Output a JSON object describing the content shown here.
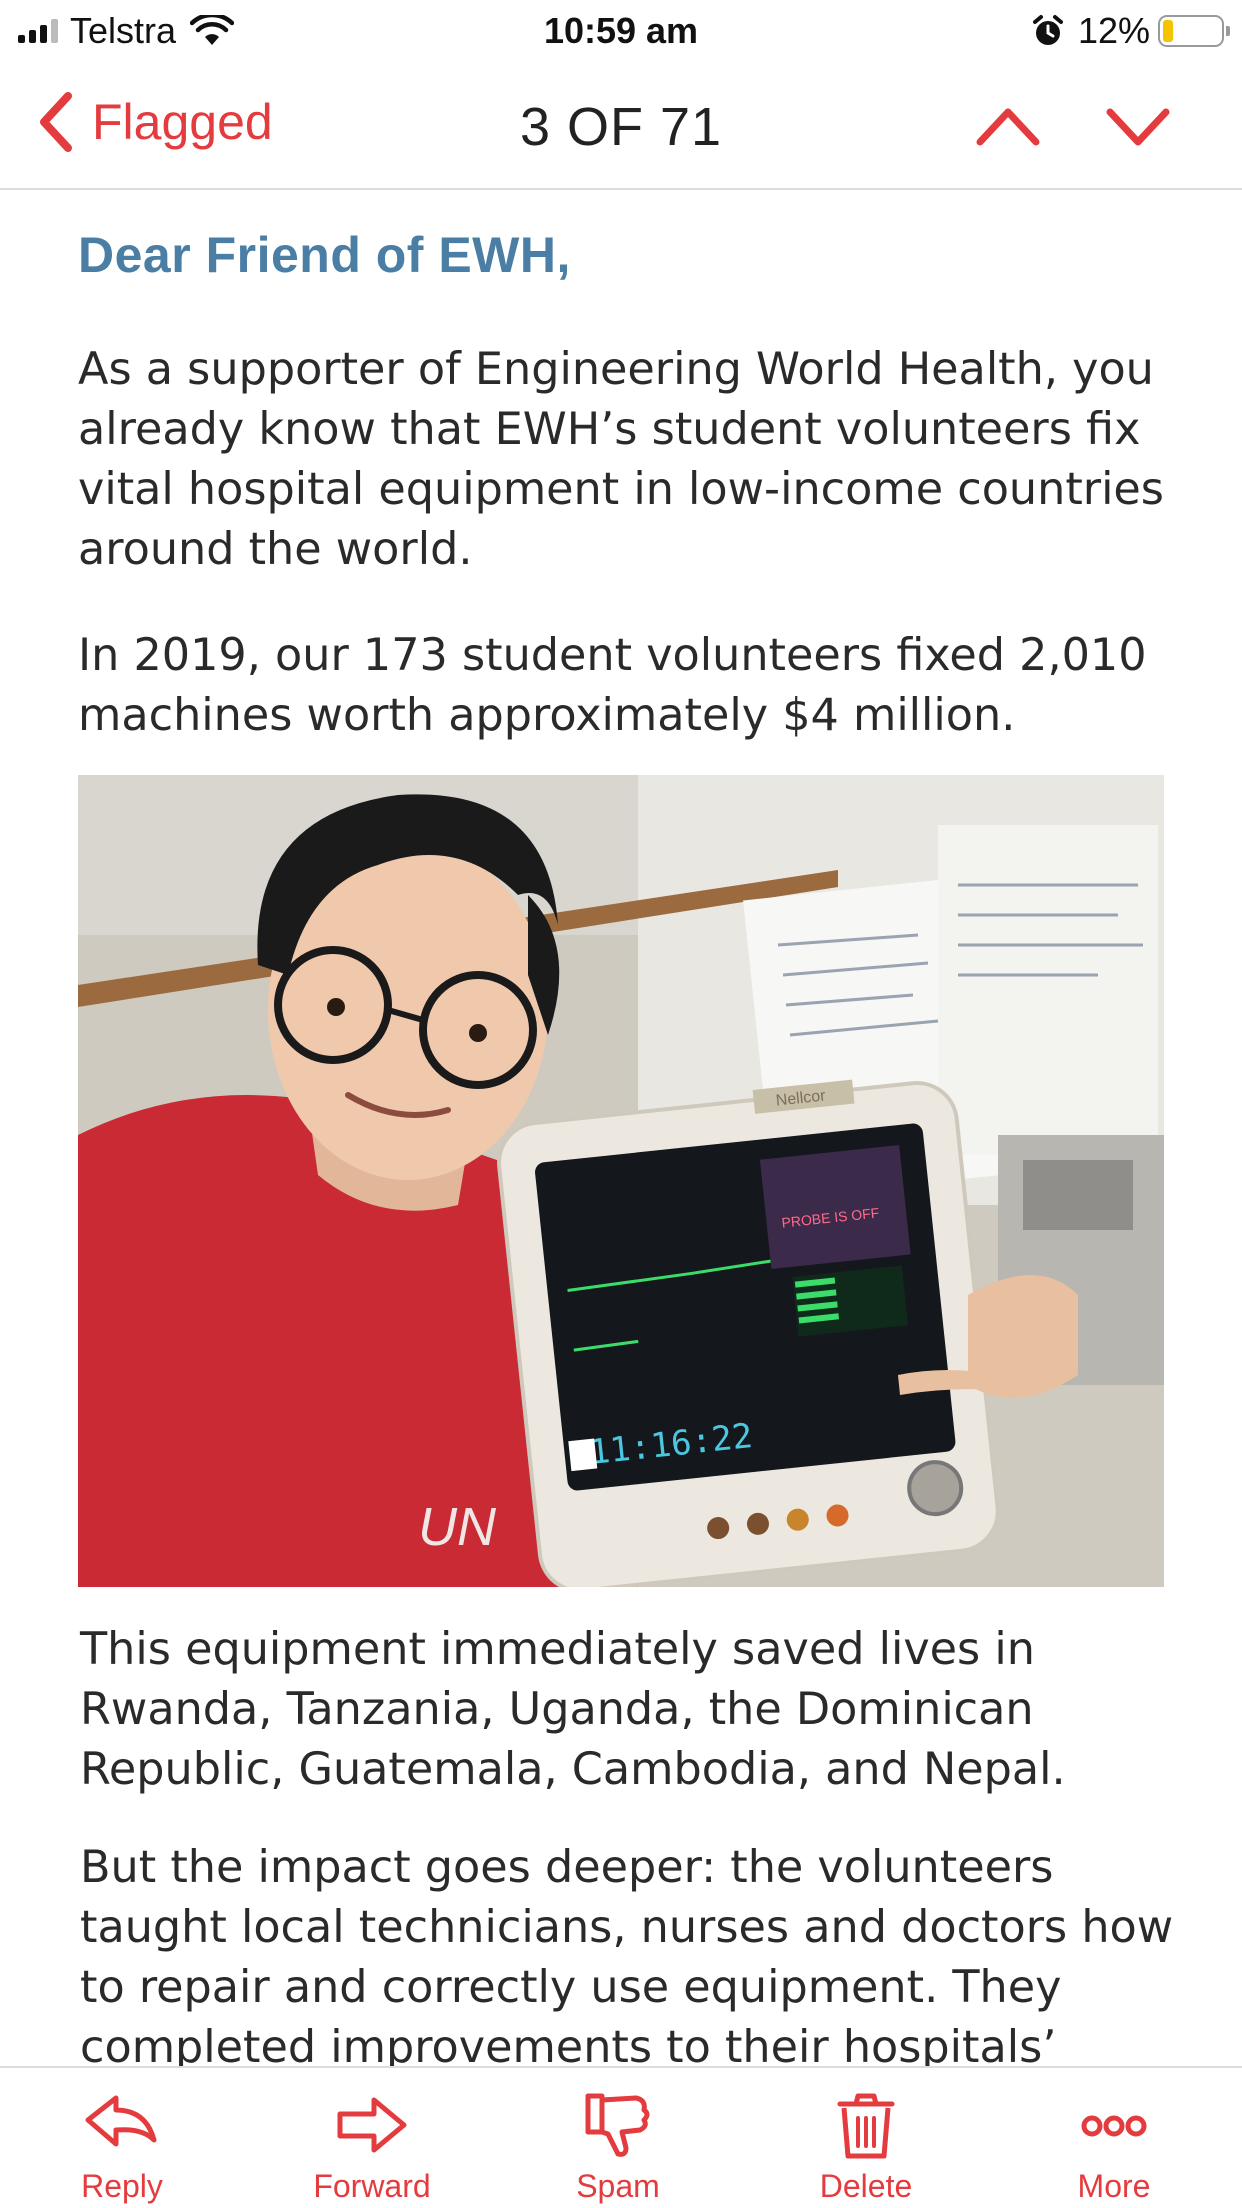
{
  "status_bar": {
    "carrier": "Telstra",
    "time": "10:59 am",
    "battery_percent": "12%",
    "battery_level": 0.12,
    "icons": [
      "signal-icon",
      "wifi-icon",
      "alarm-icon",
      "battery-icon"
    ]
  },
  "nav": {
    "back_label": "Flagged",
    "counter": "3 OF 71",
    "accent_color": "#e43b3f"
  },
  "email": {
    "greeting": "Dear Friend of EWH,",
    "paragraphs": [
      "As a supporter of Engineering World Health, you already know that EWH’s student volunteers fix vital hospital equipment in low-income countries around the world.",
      "In 2019, our 173 student volunteers fixed 2,010 machines worth approximately $4 million.",
      "This equipment immediately saved lives in Rwanda, Tanzania, Uganda, the Dominican Republic, Guatemala, Cambodia, and Nepal.",
      "But the impact goes deeper: the volunteers taught local technicians, nurses and doctors how to repair and correctly use equipment. They completed improvements to their hospitals’"
    ],
    "photo": {
      "brand_label": "Nellcor",
      "monitor_time": "11:16:22",
      "shirt_text": "UN"
    },
    "greeting_color": "#4a7ea4"
  },
  "toolbar": {
    "reply": "Reply",
    "forward": "Forward",
    "spam": "Spam",
    "delete": "Delete",
    "more": "More"
  }
}
